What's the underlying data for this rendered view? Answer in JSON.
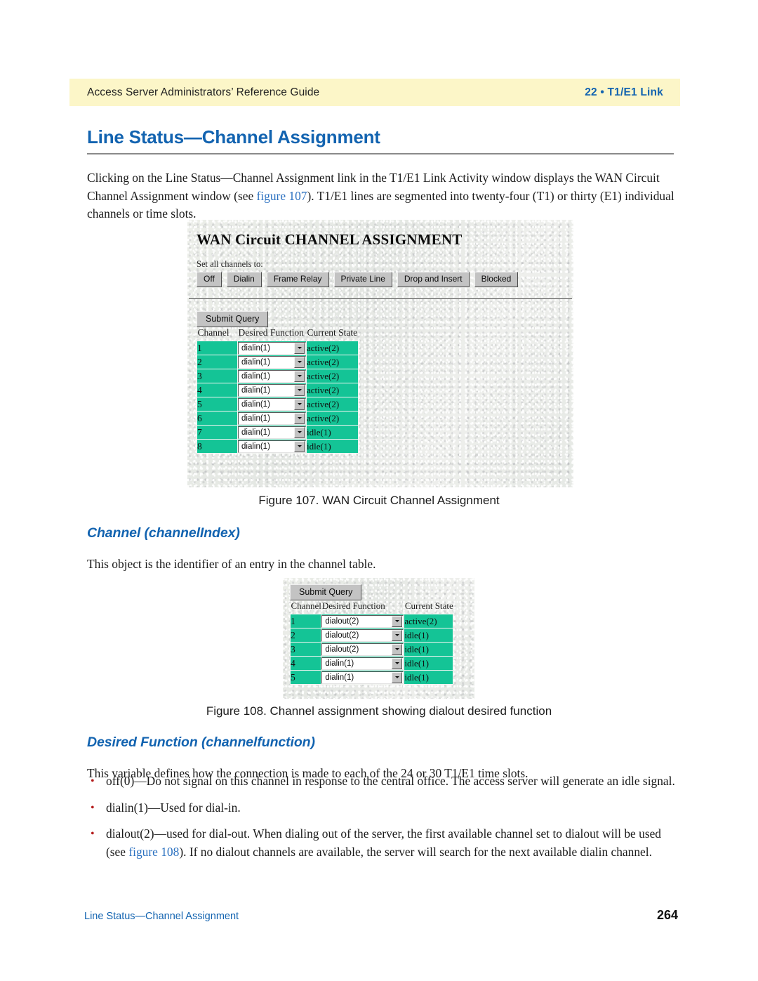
{
  "header": {
    "left": "Access Server Administrators’ Reference Guide",
    "right": "22 • T1/E1 Link"
  },
  "page_title": "Line Status—Channel Assignment",
  "intro_paragraph": {
    "part1": "Clicking on the Line Status—Channel Assignment link in the T1/E1 Link Activity window displays the WAN Circuit Channel Assignment window (see ",
    "link": "figure 107",
    "part2": "). T1/E1 lines are segmented into twenty-four (T1) or thirty (E1) individual channels or time slots."
  },
  "figure107": {
    "title": "WAN Circuit CHANNEL ASSIGNMENT",
    "set_all_label": "Set all channels to:",
    "buttons": [
      "Off",
      "Dialin",
      "Frame Relay",
      "Private Line",
      "Drop and Insert",
      "Blocked"
    ],
    "submit_label": "Submit Query",
    "columns": [
      "Channel",
      "Desired Function",
      "Current State"
    ],
    "rows": [
      {
        "channel": "1",
        "function": "dialin(1)",
        "state": "active(2)"
      },
      {
        "channel": "2",
        "function": "dialin(1)",
        "state": "active(2)"
      },
      {
        "channel": "3",
        "function": "dialin(1)",
        "state": "active(2)"
      },
      {
        "channel": "4",
        "function": "dialin(1)",
        "state": "active(2)"
      },
      {
        "channel": "5",
        "function": "dialin(1)",
        "state": "active(2)"
      },
      {
        "channel": "6",
        "function": "dialin(1)",
        "state": "active(2)"
      },
      {
        "channel": "7",
        "function": "dialin(1)",
        "state": "idle(1)"
      },
      {
        "channel": "8",
        "function": "dialin(1)",
        "state": "idle(1)"
      }
    ],
    "caption": "Figure 107. WAN Circuit Channel Assignment"
  },
  "section_channel": {
    "heading": "Channel (channelIndex)",
    "paragraph": "This object is the identifier of an entry in the channel table."
  },
  "figure108": {
    "submit_label": "Submit Query",
    "columns": [
      "Channel",
      "Desired Function",
      "Current State"
    ],
    "rows": [
      {
        "channel": "1",
        "function": "dialout(2)",
        "state": "active(2)"
      },
      {
        "channel": "2",
        "function": "dialout(2)",
        "state": "idle(1)"
      },
      {
        "channel": "3",
        "function": "dialout(2)",
        "state": "idle(1)"
      },
      {
        "channel": "4",
        "function": "dialin(1)",
        "state": "idle(1)"
      },
      {
        "channel": "5",
        "function": "dialin(1)",
        "state": "idle(1)"
      }
    ],
    "caption": "Figure 108. Channel assignment showing dialout desired function"
  },
  "section_function": {
    "heading": "Desired Function (channelfunction)",
    "paragraph": "This variable defines how the connection is made to each of the 24 or 30 T1/E1 time slots.",
    "bullets": [
      {
        "text": "off(0)—Do not signal on this channel in response to the central office. The access server will generate an idle signal."
      },
      {
        "text": "dialin(1)—Used for dial-in."
      },
      {
        "part1": "dialout(2)—used for dial-out. When dialing out of the server, the first available channel set to dialout will be used (see ",
        "link": "figure 108",
        "part2": "). If no dialout channels are available, the server will search for the next available dialin channel."
      }
    ]
  },
  "footer": {
    "left": "Line Status—Channel Assignment",
    "page_number": "264"
  },
  "colors": {
    "accent_blue": "#1263b0",
    "banner_yellow": "#fcf6c8",
    "table_green": "#14c496",
    "bullet_red": "#b41b1b"
  }
}
